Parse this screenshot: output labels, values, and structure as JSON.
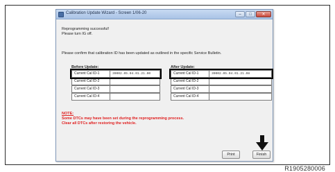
{
  "window": {
    "title": "Calibration Update Wizard - Screen 1/06-20",
    "minimize_glyph": "–",
    "maximize_glyph": "□",
    "close_glyph": "✕"
  },
  "messages": {
    "line1": "Reprogramming successful!",
    "line2": "Please turn IG off.",
    "line3": "Please confirm that calibration ID has been updated as outlined in the specific Service Bulletin."
  },
  "before_update": {
    "heading": "Before Update:",
    "rows": [
      {
        "label": "Current Cal ID-1",
        "value": "39002.05.04.01.21.00"
      },
      {
        "label": "Current Cal ID-2",
        "value": ""
      },
      {
        "label": "Current Cal ID-3",
        "value": ""
      },
      {
        "label": "Current Cal ID-4",
        "value": ""
      }
    ]
  },
  "after_update": {
    "heading": "After Update:",
    "rows": [
      {
        "label": "Current Cal ID-1",
        "value": "39002.05.04.01.21.08"
      },
      {
        "label": "Current Cal ID-2",
        "value": ""
      },
      {
        "label": "Current Cal ID-3",
        "value": ""
      },
      {
        "label": "Current Cal ID-4",
        "value": ""
      }
    ]
  },
  "note": {
    "heading": "NOTE:",
    "line1": "Some DTCs may have been set during the reprogramming process.",
    "line2": "Clear all DTCs after restoring the vehicle.",
    "color": "#e02020"
  },
  "buttons": {
    "print": "Print",
    "finish": "Finish"
  },
  "figure_id": "R1905280006",
  "icons": {
    "callout_arrow": "arrow-down-icon"
  }
}
